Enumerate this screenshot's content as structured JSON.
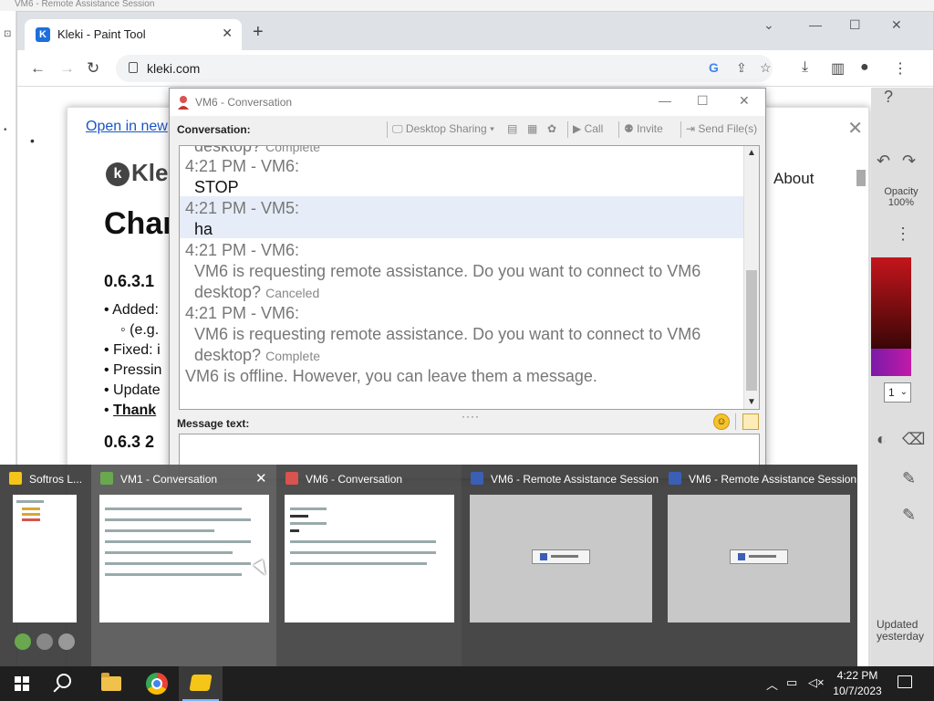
{
  "remote_titlebar": "VM6 - Remote Assistance Session",
  "browser": {
    "tab_title": "Kleki - Paint Tool",
    "tab_favicon": "K",
    "url": "kleki.com"
  },
  "kleki": {
    "open_link": "Open in new",
    "logo": "Kleki",
    "about": "About",
    "heading": "Char",
    "version1": "0.6.3.1",
    "items": [
      "Added:",
      "(e.g.",
      "Fixed: i",
      "Pressin",
      "Update",
      "Thank "
    ],
    "version2": "0.6.3   2",
    "opacity_label": "Opacity",
    "opacity_value": "100%",
    "brush_size": "1",
    "updated": "Updated",
    "updated_when": "yesterday"
  },
  "conversation": {
    "window_title": "VM6 - Conversation",
    "label": "Conversation:",
    "toolbar": {
      "desktop_sharing": "Desktop Sharing",
      "call": "Call",
      "invite": "Invite",
      "send_files": "Send File(s)"
    },
    "messages": [
      {
        "kind": "status",
        "text": "desktop?",
        "status": "Complete"
      },
      {
        "kind": "header",
        "text": "4:21 PM - VM6:"
      },
      {
        "kind": "body",
        "text": "STOP"
      },
      {
        "kind": "header",
        "text": "4:21 PM - VM5:"
      },
      {
        "kind": "body",
        "text": "ha"
      },
      {
        "kind": "header",
        "text": "4:21 PM - VM6:"
      },
      {
        "kind": "gray",
        "text": "VM6 is requesting remote assistance. Do you want to connect to VM6"
      },
      {
        "kind": "status",
        "text": "desktop?",
        "status": "Canceled"
      },
      {
        "kind": "header",
        "text": "4:21 PM - VM6:"
      },
      {
        "kind": "gray",
        "text": "VM6 is requesting remote assistance. Do you want to connect to VM6"
      },
      {
        "kind": "status",
        "text": "desktop?",
        "status": "Complete"
      },
      {
        "kind": "offline",
        "text": "VM6 is offline. However, you can leave them a message."
      }
    ],
    "message_text_label": "Message text:",
    "message_value": ""
  },
  "thumbnails": [
    {
      "title": "Softros L...",
      "icon": "chat-bubble-icon"
    },
    {
      "title": "VM1 - Conversation",
      "icon": "user-icon"
    },
    {
      "title": "VM6 - Conversation",
      "icon": "user-icon"
    },
    {
      "title": "VM6 - Remote Assistance Session",
      "icon": "remote-session-icon"
    },
    {
      "title": "VM6 - Remote Assistance Session",
      "icon": "remote-session-icon"
    }
  ],
  "taskbar": {
    "time": "4:22 PM",
    "date": "10/7/2023"
  },
  "colors": {
    "taskbar_bg": "#1f1f1f",
    "thumb_bg": "#3a3a3a",
    "accent": "#1a56c8",
    "highlight_row": "#e6edf8"
  }
}
